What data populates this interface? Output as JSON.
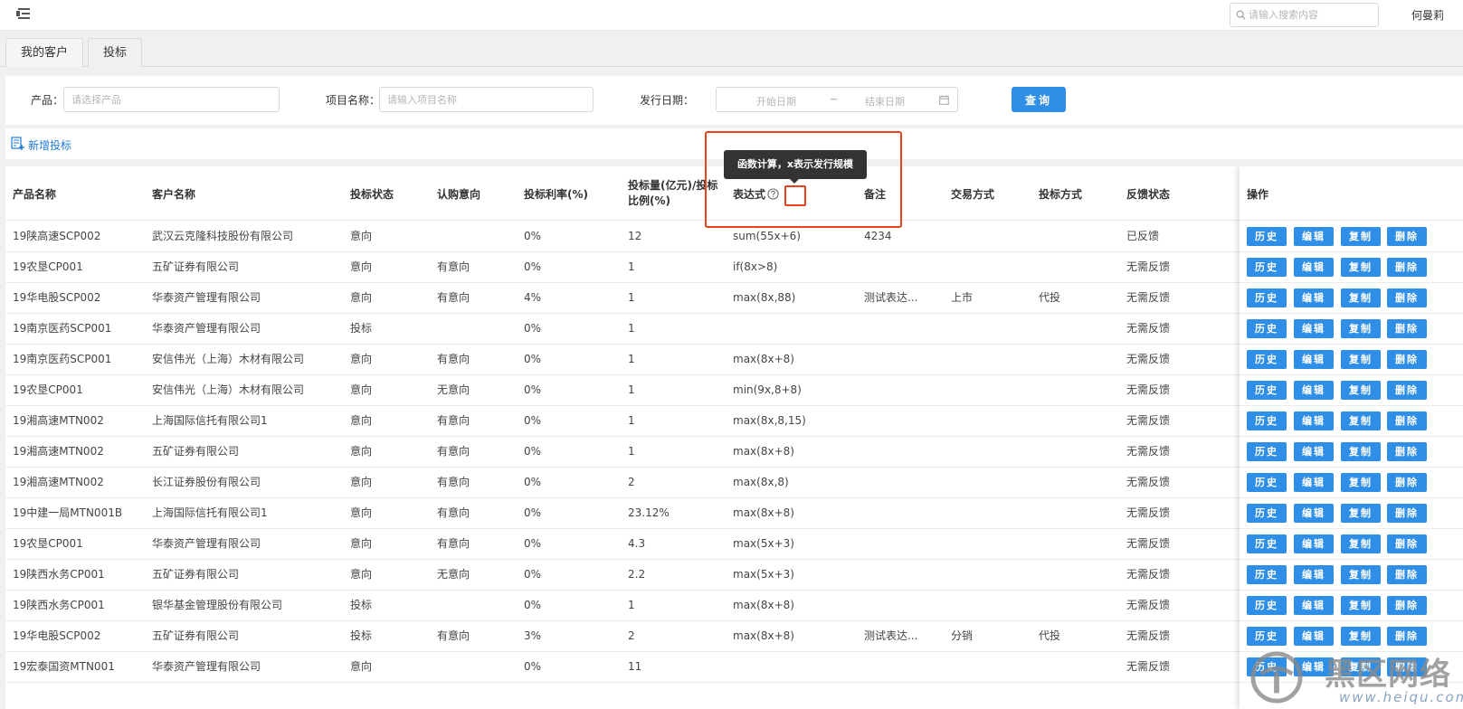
{
  "header": {
    "search_placeholder": "请输入搜索内容",
    "user_name": "何曼莉"
  },
  "tabs": [
    {
      "label": "我的客户"
    },
    {
      "label": "投标"
    }
  ],
  "filters": {
    "product_label": "产品：",
    "product_placeholder": "请选择产品",
    "project_label": "项目名称：",
    "project_placeholder": "请输入项目名称",
    "date_label": "发行日期：",
    "date_start_placeholder": "开始日期",
    "date_separator": "~",
    "date_end_placeholder": "结束日期",
    "query_button": "查询"
  },
  "toolbar": {
    "add_label": "新增投标"
  },
  "tooltip": {
    "text": "函数计算，x表示发行规模"
  },
  "table": {
    "columns": [
      "产品名称",
      "客户名称",
      "投标状态",
      "认购意向",
      "投标利率(%)",
      "投标量(亿元)/投标比例(%)",
      "表达式",
      "备注",
      "交易方式",
      "投标方式",
      "反馈状态",
      "操作"
    ],
    "actions": [
      "历史",
      "编辑",
      "复制",
      "删除"
    ],
    "rows": [
      [
        "19陕高速SCP002",
        "武汉云克隆科技股份有限公司",
        "意向",
        "",
        "0%",
        "12",
        "sum(55x+6)",
        "4234",
        "",
        "",
        "已反馈"
      ],
      [
        "19农垦CP001",
        "五矿证券有限公司",
        "意向",
        "有意向",
        "0%",
        "1",
        "if(8x>8)",
        "",
        "",
        "",
        "无需反馈"
      ],
      [
        "19华电股SCP002",
        "华泰资产管理有限公司",
        "意向",
        "有意向",
        "4%",
        "1",
        "max(8x,88)",
        "测试表达...",
        "上市",
        "代投",
        "无需反馈"
      ],
      [
        "19南京医药SCP001",
        "华泰资产管理有限公司",
        "投标",
        "",
        "0%",
        "1",
        "",
        "",
        "",
        "",
        "无需反馈"
      ],
      [
        "19南京医药SCP001",
        "安信伟光（上海）木材有限公司",
        "意向",
        "有意向",
        "0%",
        "1",
        "max(8x+8)",
        "",
        "",
        "",
        "无需反馈"
      ],
      [
        "19农垦CP001",
        "安信伟光（上海）木材有限公司",
        "意向",
        "无意向",
        "0%",
        "1",
        "min(9x,8+8)",
        "",
        "",
        "",
        "无需反馈"
      ],
      [
        "19湘高速MTN002",
        "上海国际信托有限公司1",
        "意向",
        "有意向",
        "0%",
        "1",
        "max(8x,8,15)",
        "",
        "",
        "",
        "无需反馈"
      ],
      [
        "19湘高速MTN002",
        "五矿证券有限公司",
        "意向",
        "有意向",
        "0%",
        "1",
        "max(8x+8)",
        "",
        "",
        "",
        "无需反馈"
      ],
      [
        "19湘高速MTN002",
        "长江证券股份有限公司",
        "意向",
        "有意向",
        "0%",
        "2",
        "max(8x,8)",
        "",
        "",
        "",
        "无需反馈"
      ],
      [
        "19中建一局MTN001B",
        "上海国际信托有限公司1",
        "意向",
        "有意向",
        "0%",
        "23.12%",
        "max(8x+8)",
        "",
        "",
        "",
        "无需反馈"
      ],
      [
        "19农垦CP001",
        "华泰资产管理有限公司",
        "意向",
        "有意向",
        "0%",
        "4.3",
        "max(5x+3)",
        "",
        "",
        "",
        "无需反馈"
      ],
      [
        "19陕西水务CP001",
        "五矿证券有限公司",
        "意向",
        "无意向",
        "0%",
        "2.2",
        "max(5x+3)",
        "",
        "",
        "",
        "无需反馈"
      ],
      [
        "19陕西水务CP001",
        "银华基金管理股份有限公司",
        "投标",
        "",
        "0%",
        "1",
        "max(8x+8)",
        "",
        "",
        "",
        "无需反馈"
      ],
      [
        "19华电股SCP002",
        "五矿证券有限公司",
        "投标",
        "有意向",
        "3%",
        "2",
        "max(8x+8)",
        "测试表达...",
        "分销",
        "代投",
        "无需反馈"
      ],
      [
        "19宏泰国资MTN001",
        "华泰资产管理有限公司",
        "意向",
        "",
        "0%",
        "11",
        "",
        "",
        "",
        "",
        "无需反馈"
      ]
    ]
  },
  "watermark": {
    "title": "黑区网络",
    "url": "www.heiqu.com"
  },
  "colors": {
    "primary": "#2f8ee6",
    "annotation": "#e8431e",
    "tooltip_bg": "#333333",
    "link": "#1f7ad8"
  }
}
